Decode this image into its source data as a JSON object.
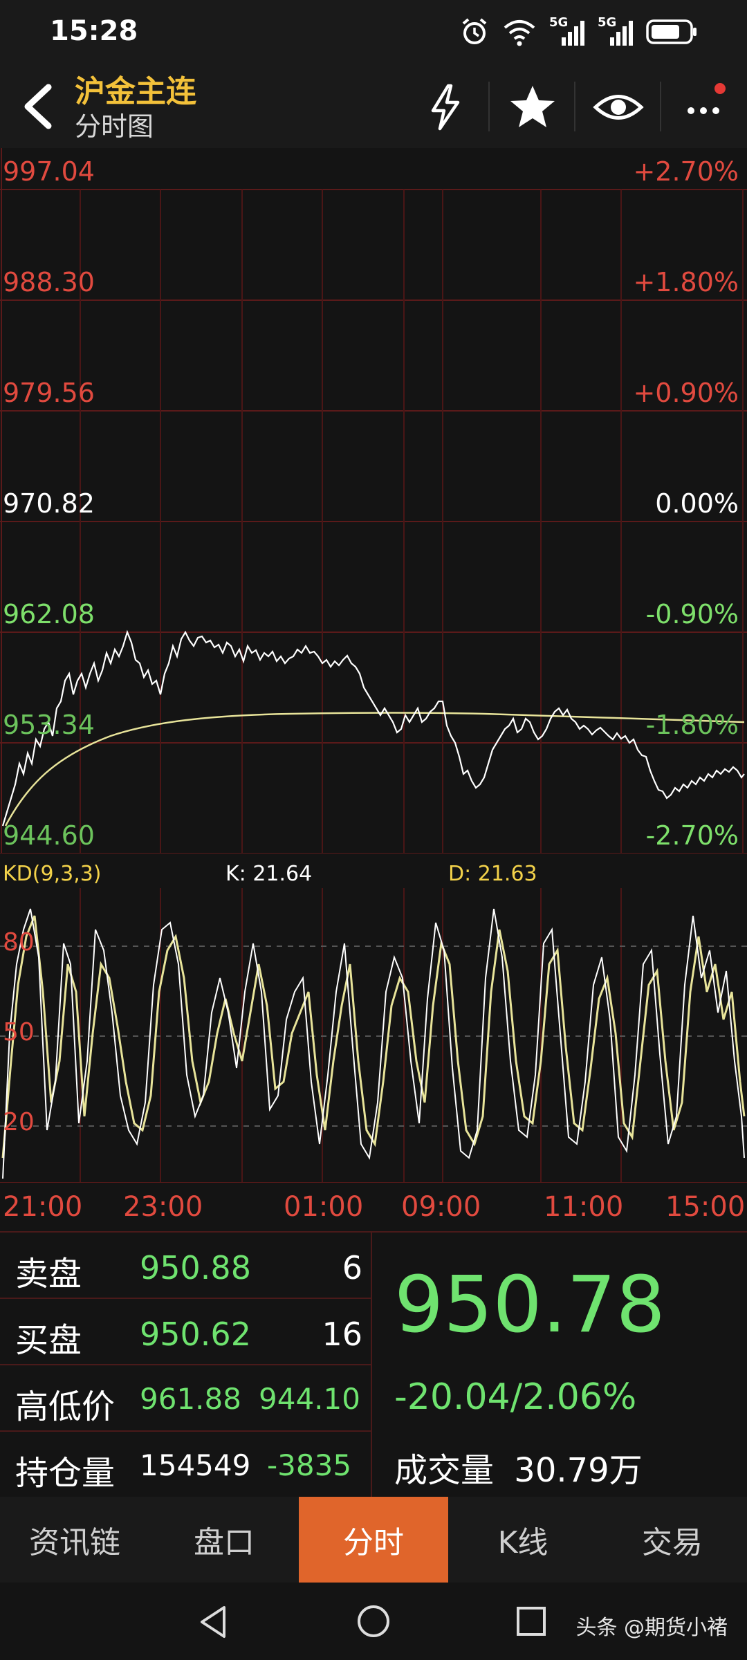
{
  "status": {
    "time": "15:28",
    "signal_label_1": "5G",
    "signal_label_2": "5G"
  },
  "header": {
    "title": "沪金主连",
    "subtitle": "分时图",
    "icons": [
      "back-arrow-icon",
      "lightning-icon",
      "star-icon",
      "eye-icon",
      "more-icon"
    ],
    "notification_dot_color": "#e53935"
  },
  "main_chart": {
    "price_labels": [
      "997.04",
      "988.30",
      "979.56",
      "970.82",
      "962.08",
      "953.34",
      "944.60"
    ],
    "percent_labels": [
      "+2.70%",
      "+1.80%",
      "+0.90%",
      "0.00%",
      "-0.90%",
      "-1.80%",
      "-2.70%"
    ],
    "colors": {
      "up": "#e14a3f",
      "neutral": "#ffffff",
      "down": "#7ee06b",
      "price_line": "#ffffff",
      "avg_line": "#e8e49a",
      "grid": "#5a1a1a"
    }
  },
  "kd": {
    "title": "KD(9,3,3)",
    "k_label": "K: 21.64",
    "d_label": "D: 21.63",
    "levels": [
      "80",
      "50",
      "20"
    ]
  },
  "time_axis": [
    "21:00",
    "23:00",
    "01:00",
    "09:00",
    "11:00",
    "15:00"
  ],
  "chart_data": {
    "type": "line",
    "x": [
      "21:00",
      "23:00",
      "01:00",
      "09:00",
      "11:00",
      "15:00"
    ],
    "series": [],
    "ylim": [
      944.6,
      997.04
    ]
  },
  "quote": {
    "sell": {
      "label": "卖盘",
      "price": "950.88",
      "qty": "6"
    },
    "buy": {
      "label": "买盘",
      "price": "950.62",
      "qty": "16"
    },
    "high_low": {
      "label": "高低价",
      "high": "961.88",
      "low": "944.10"
    },
    "position": {
      "label": "持仓量",
      "value": "154549",
      "change": "-3835"
    },
    "last_price": "950.78",
    "change": "-20.04/2.06%",
    "volume_label": "成交量",
    "volume_value": "30.79万"
  },
  "tabs": [
    {
      "label": "资讯链",
      "active": false
    },
    {
      "label": "盘口",
      "active": false
    },
    {
      "label": "分时",
      "active": true
    },
    {
      "label": "K线",
      "active": false
    },
    {
      "label": "交易",
      "active": false
    }
  ],
  "watermark": "头条 @期货小褚"
}
